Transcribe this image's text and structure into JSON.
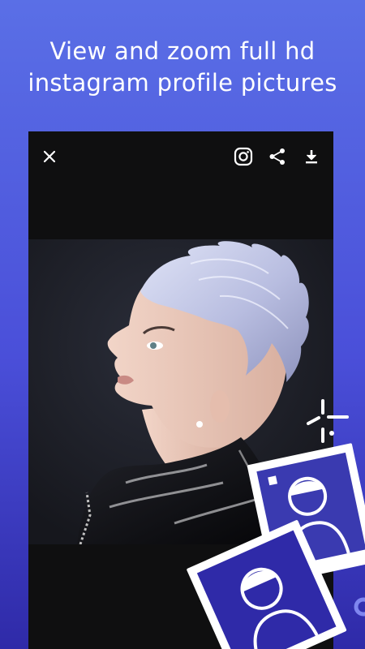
{
  "headline": {
    "line1": "View and zoom full hd",
    "line2": "instagram profile pictures"
  },
  "viewer": {
    "toolbar": {
      "close_icon": "close-icon",
      "instagram_icon": "instagram-icon",
      "share_icon": "share-icon",
      "download_icon": "download-icon"
    },
    "image": "profile-picture"
  },
  "colors": {
    "background_top": "#5a6fe6",
    "background_bottom": "#2f2aa8",
    "viewer_background": "#0f0f10",
    "icon": "#ffffff"
  }
}
